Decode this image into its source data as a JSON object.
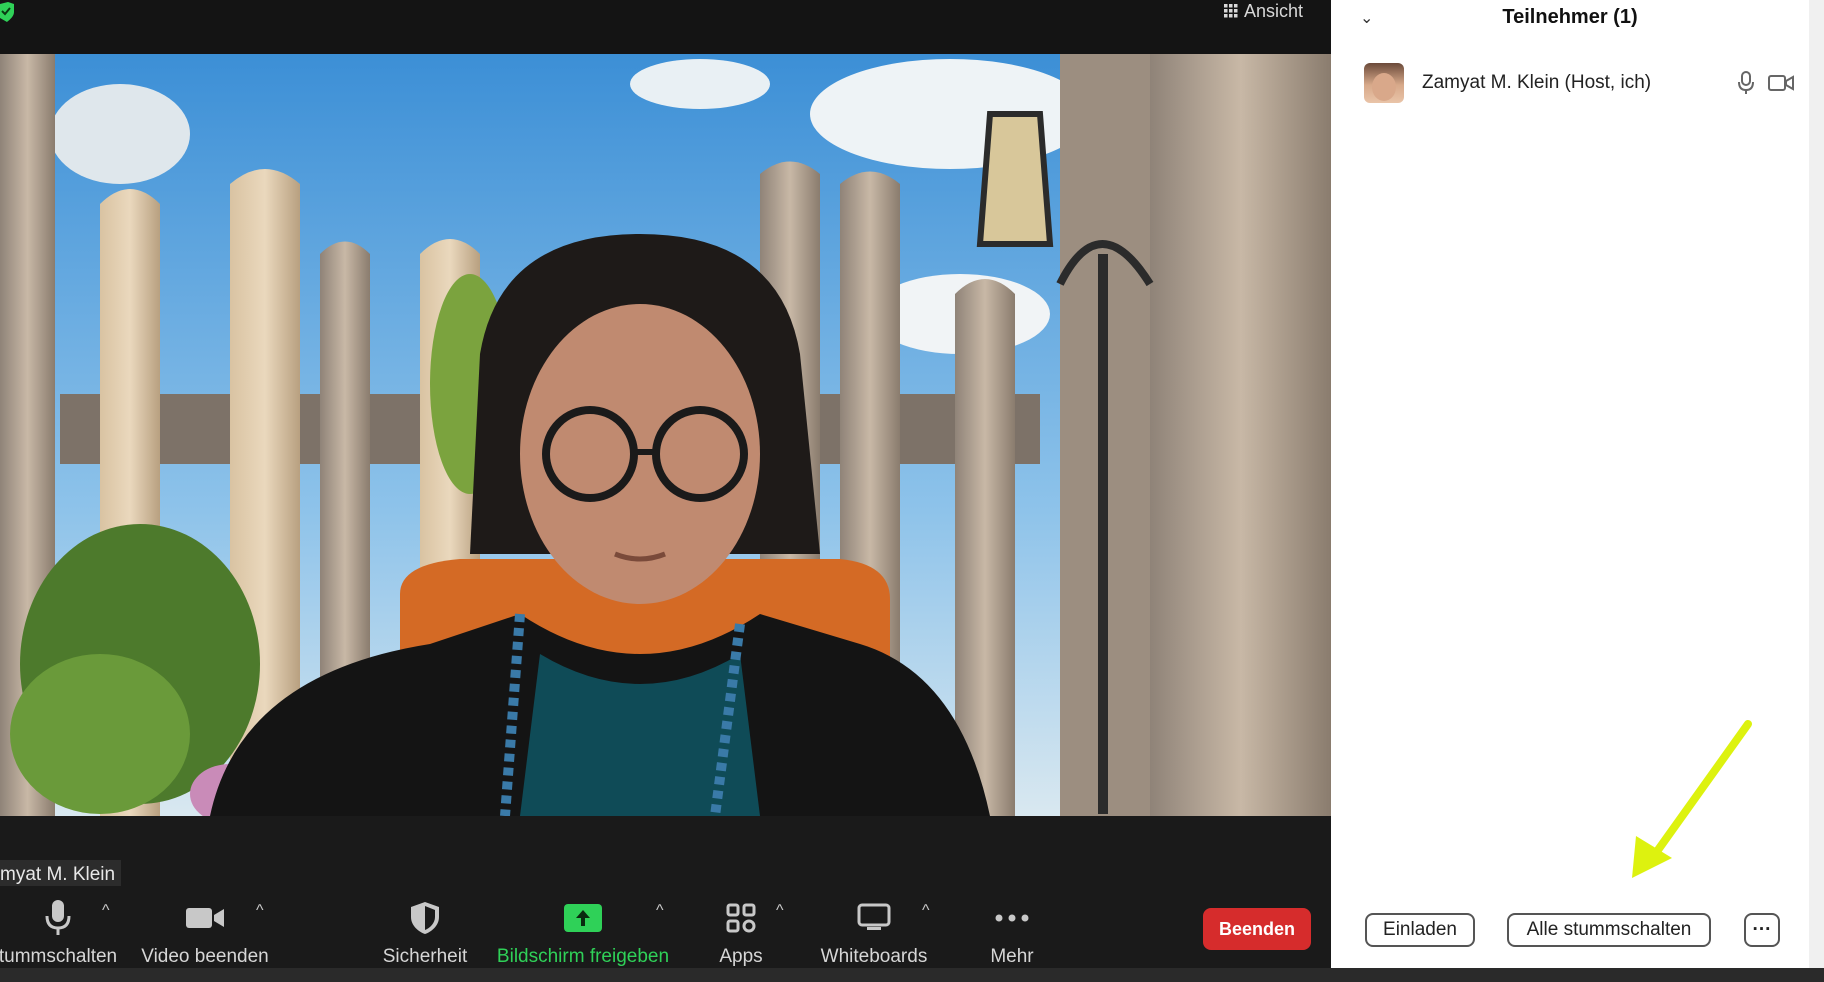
{
  "topbar": {
    "view_label": "Ansicht",
    "view_icon": "grid-icon",
    "security_badge": "shield-check-icon"
  },
  "video": {
    "participant_name": "myat M. Klein"
  },
  "toolbar": {
    "mute_label": "tummschalten",
    "video_label": "Video beenden",
    "security_label": "Sicherheit",
    "share_label": "Bildschirm freigeben",
    "apps_label": "Apps",
    "whiteboards_label": "Whiteboards",
    "more_label": "Mehr",
    "end_label": "Beenden",
    "accent_green": "#2fd158",
    "end_color": "#d62c2c"
  },
  "participants_panel": {
    "title": "Teilnehmer (1)",
    "participants": [
      {
        "name": "Zamyat M. Klein (Host, ich)"
      }
    ],
    "invite_label": "Einladen",
    "mute_all_label": "Alle stummschalten",
    "more_label": "···"
  },
  "annotation": {
    "arrow_color": "#ddf20f"
  }
}
